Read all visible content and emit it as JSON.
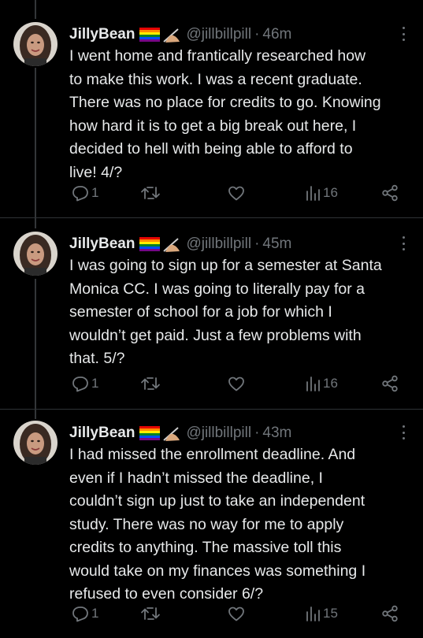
{
  "tweets": [
    {
      "display_name": "JillyBean",
      "handle": "@jillbillpill",
      "separator": "·",
      "time": "46m",
      "text": "I went home and frantically researched how\nto make this work. I was a recent graduate.\nThere was no place for credits to go. Knowing\nhow hard it is to get a big break out here, I\ndecided to hell with being able to afford to\nlive! 4/?",
      "replies": "1",
      "views": "16"
    },
    {
      "display_name": "JillyBean",
      "handle": "@jillbillpill",
      "separator": "·",
      "time": "45m",
      "text": "I was going to sign up for a semester at Santa\nMonica CC. I was going to literally pay for a\nsemester of school for a job for which I\nwouldn’t get paid. Just a few problems with\nthat. 5/?",
      "replies": "1",
      "views": "16"
    },
    {
      "display_name": "JillyBean",
      "handle": "@jillbillpill",
      "separator": "·",
      "time": "43m",
      "text": "I had missed the enrollment deadline. And\neven if I hadn’t missed the deadline, I\ncouldn’t sign up just to take an independent\nstudy. There was no way for me to apply\ncredits to anything. The massive toll this\nwould take on my finances was something I\nrefused to even consider 6/?",
      "replies": "1",
      "views": "15"
    }
  ],
  "icons": {
    "emoji": [
      "rainbow-flag-icon",
      "writing-hand-icon"
    ],
    "actions": [
      "reply-icon",
      "retweet-icon",
      "like-icon",
      "views-icon",
      "share-icon"
    ]
  },
  "colors": {
    "background": "#000000",
    "primary_text": "#e7e9ea",
    "secondary_text": "#71767b",
    "divider": "#2f3336"
  }
}
